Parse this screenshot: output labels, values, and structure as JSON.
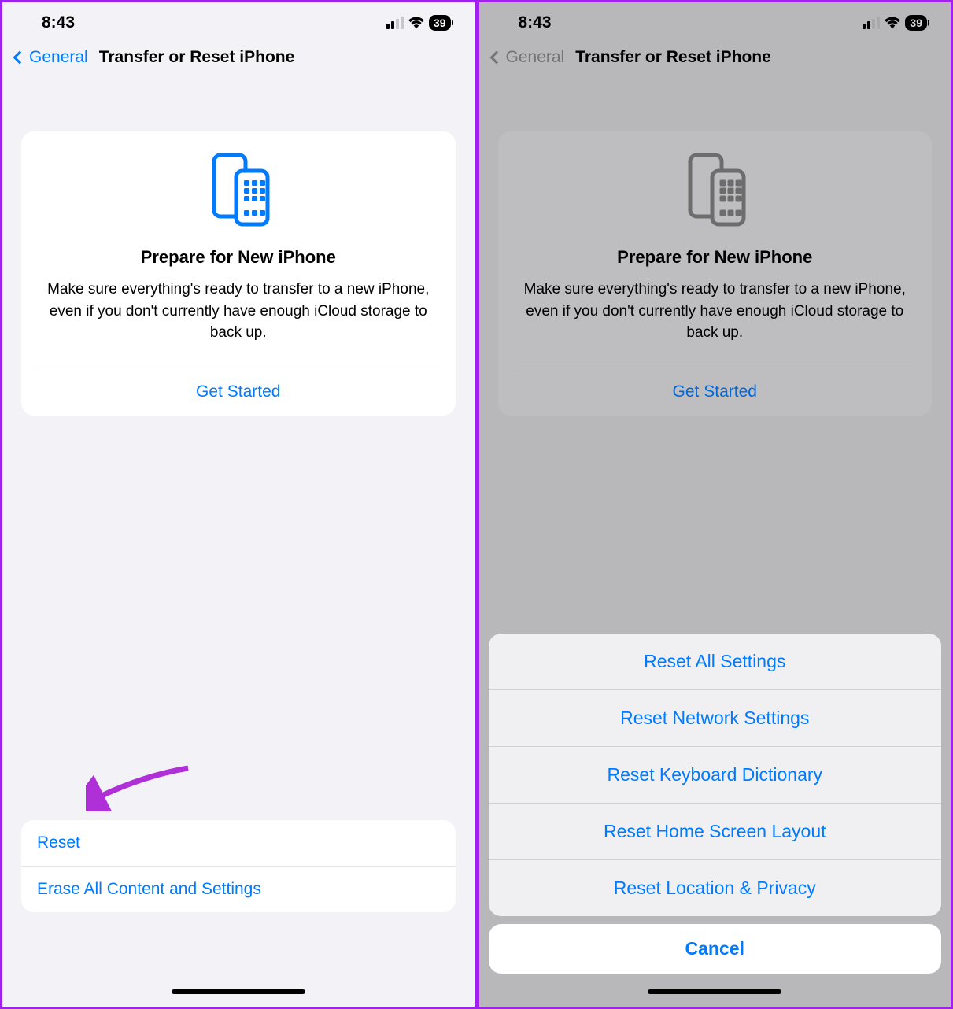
{
  "statusBar": {
    "time": "8:43",
    "batteryPercent": "39"
  },
  "nav": {
    "back": "General",
    "title": "Transfer or Reset iPhone"
  },
  "prepareCard": {
    "title": "Prepare for New iPhone",
    "description": "Make sure everything's ready to transfer to a new iPhone, even if you don't currently have enough iCloud storage to back up.",
    "cta": "Get Started"
  },
  "bottomOptions": {
    "reset": "Reset",
    "erase": "Erase All Content and Settings"
  },
  "actionSheet": {
    "items": [
      "Reset All Settings",
      "Reset Network Settings",
      "Reset Keyboard Dictionary",
      "Reset Home Screen Layout",
      "Reset Location & Privacy"
    ],
    "cancel": "Cancel"
  }
}
